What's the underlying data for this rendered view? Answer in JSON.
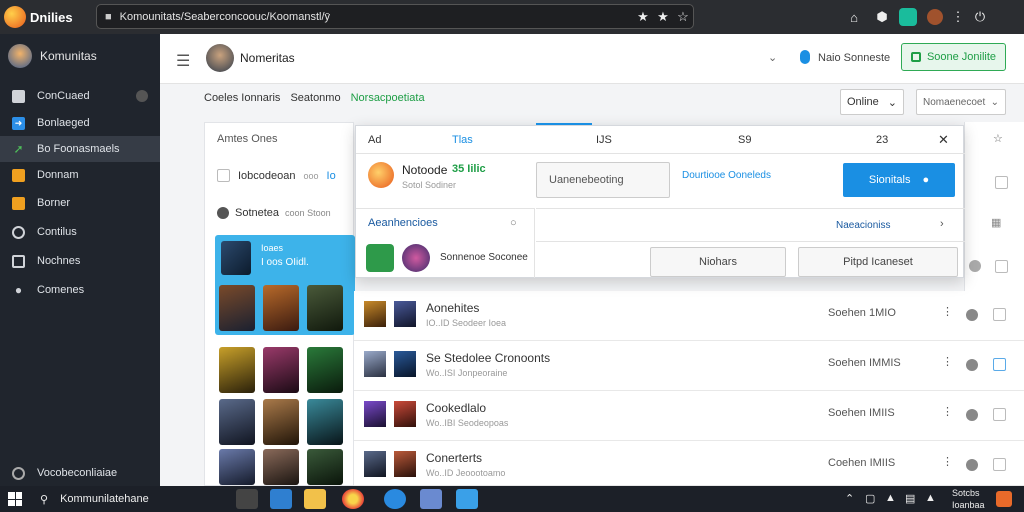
{
  "browser": {
    "logo_text": "Dnilies",
    "url": "Komounitats/Seaberconcoouc/Koomanstl/ȳ",
    "star_icons": [
      "star-icon",
      "star-icon",
      "star-outline-icon"
    ],
    "right_icons": [
      "home-icon",
      "extension-icon",
      "profile-icon",
      "avatar-icon",
      "menu-dots-icon",
      "power-icon"
    ]
  },
  "sidebar": {
    "brand": "Komunitas",
    "items": [
      {
        "label": "ConCuaed",
        "icon": "home-icon",
        "color": "#d0d3d8"
      },
      {
        "label": "Bonlaeged",
        "icon": "arrow-icon",
        "color": "#2c8fe8"
      },
      {
        "label": "Bo Foonasmaels",
        "icon": "trend-icon",
        "color": "#4fc15a"
      },
      {
        "label": "Donnam",
        "icon": "star-icon",
        "color": "#f0a020"
      },
      {
        "label": "Borner",
        "icon": "chart-icon",
        "color": "#f0a020"
      },
      {
        "label": "Contilus",
        "icon": "settings-icon",
        "color": "#d0d3d8"
      },
      {
        "label": "Nochnes",
        "icon": "mail-icon",
        "color": "#d0d3d8"
      },
      {
        "label": "Comenes",
        "icon": "people-icon",
        "color": "#d0d3d8"
      }
    ],
    "footer": "Vocobeconliaiae"
  },
  "topbar": {
    "title": "Nomeritas",
    "account_label": "Naio Sonneste",
    "cta_label": "Soone Jonilite"
  },
  "tabs": [
    {
      "label": "Coeles Ionnaris"
    },
    {
      "label": "Seatonmo"
    },
    {
      "label": "Norsacpoetiata",
      "active": true
    }
  ],
  "filters": {
    "online_select": "Online",
    "second_select": "Nomaenecoet"
  },
  "leftpanel": {
    "header": "Amtes Ones",
    "row1": "Iobcodeoan",
    "row1_small": "ooo",
    "row1_right": "Io",
    "row2": "Sotnetea",
    "row2_small": "coon Stoon",
    "feature_title": "Ioaes",
    "feature_sub": "I oos OIidl."
  },
  "popup": {
    "columns": [
      "Ad",
      "Tlas",
      "IJS",
      "S9",
      "23"
    ],
    "user_name": "Notoode",
    "user_score": "35 Iilic",
    "user_sub": "Sotol Sodiner",
    "field_placeholder": "Uanenebeoting",
    "link_text": "Dourtiooe Ooneleds",
    "button_label": "Sionitals",
    "section_label": "Aeanhencioes",
    "list_label": "Sonnenoe Soconee",
    "next_label": "Naeacioniss",
    "button2": "Niohars",
    "button3": "Pitpd Icaneset"
  },
  "rows": [
    {
      "title": "Aonehites",
      "sub": "IO..ID   Seodeer Ioea",
      "time": "Soehen 1MIO",
      "highlight": false
    },
    {
      "title": "Se Stedolee  Cronoonts",
      "sub": "Wo..ISI  Jonpeoraine",
      "time": "Soehen IMMIS",
      "highlight": true
    },
    {
      "title": "Cookedlalo",
      "sub": "Wo..IBI  Seodeopoas",
      "time": "Soehen IMIIS",
      "highlight": false
    },
    {
      "title": "Conerterts",
      "sub": "Wo..ID   Jeoootoamo",
      "time": "Coehen IMIIS",
      "highlight": false
    }
  ],
  "taskbar": {
    "search_text": "Kommunilatehane",
    "time": "Sotcbs",
    "date": "Ioanbaa"
  },
  "colors": {
    "accent": "#1a8fe3",
    "green": "#1e9e46",
    "sidebar": "#20252d"
  }
}
